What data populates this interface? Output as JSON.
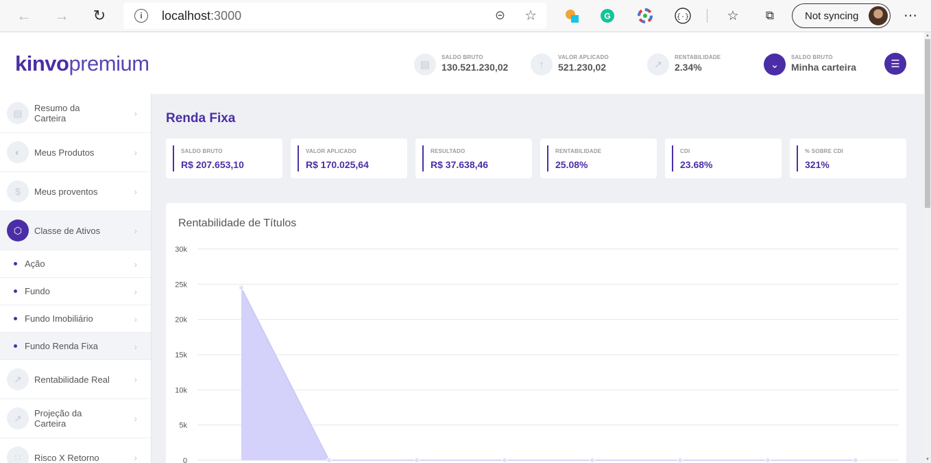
{
  "browser": {
    "url_host": "localhost",
    "url_port": ":3000",
    "sync_label": "Not syncing",
    "icons": [
      "back-arrow-icon",
      "forward-arrow-icon",
      "refresh-icon",
      "info-icon",
      "zoom-out-icon",
      "add-favorite-icon",
      "extension-icon",
      "grammarly-icon",
      "color-wheel-icon",
      "code-icon",
      "favorites-icon",
      "collections-icon",
      "more-icon"
    ]
  },
  "header": {
    "logo_bold": "kinvo",
    "logo_light": "premium",
    "stats": [
      {
        "label": "SALDO BRUTO",
        "value": "130.521.230,02",
        "icon": "wallet-icon"
      },
      {
        "label": "VALOR APLICADO",
        "value": "521.230,02",
        "icon": "arrow-up-icon"
      },
      {
        "label": "RENTABILIDADE",
        "value": "2.34%",
        "icon": "trend-icon"
      },
      {
        "label": "SALDO BRUTO",
        "value": "Minha carteira",
        "icon": "chevron-down-icon"
      }
    ]
  },
  "sidebar": {
    "items": [
      {
        "label": "Resumo da Carteira",
        "icon": "wallet-icon"
      },
      {
        "label": "Meus Produtos",
        "icon": "pie-icon"
      },
      {
        "label": "Meus proventos",
        "icon": "dollar-icon"
      },
      {
        "label": "Classe de Ativos",
        "icon": "cube-icon"
      }
    ],
    "subitems": [
      "Ação",
      "Fundo",
      "Fundo Imobiliário",
      "Fundo Renda Fixa"
    ],
    "items_after": [
      {
        "label": "Rentabilidade Real",
        "icon": "trend-icon"
      },
      {
        "label": "Projeção da Carteira",
        "icon": "trend-icon"
      },
      {
        "label": "Risco X Retorno",
        "icon": "scatter-icon"
      }
    ]
  },
  "main": {
    "title": "Renda Fixa",
    "cards": [
      {
        "label": "SALDO BRUTO",
        "value": "R$ 207.653,10"
      },
      {
        "label": "VALOR APLICADO",
        "value": "R$ 170.025,64"
      },
      {
        "label": "RESULTADO",
        "value": "R$ 37.638,46"
      },
      {
        "label": "RENTABILIDADE",
        "value": "25.08%"
      },
      {
        "label": "CDI",
        "value": "23.68%"
      },
      {
        "label": "% SOBRE CDI",
        "value": "321%"
      }
    ],
    "chart_title": "Rentabilidade de Títulos"
  },
  "colors": {
    "brand": "#4b2ea6",
    "area_fill": "#d4d2fb",
    "area_stroke": "#c9c6f5"
  },
  "chart_data": {
    "type": "area",
    "title": "Rentabilidade de Títulos",
    "y_ticks": [
      "0",
      "5k",
      "10k",
      "15k",
      "20k",
      "25k",
      "30k"
    ],
    "ylim": [
      0,
      30000
    ],
    "x_index": [
      0,
      1,
      2,
      3,
      4,
      5,
      6,
      7
    ],
    "values": [
      24500,
      0,
      0,
      0,
      0,
      0,
      0,
      0
    ],
    "grid": true
  }
}
